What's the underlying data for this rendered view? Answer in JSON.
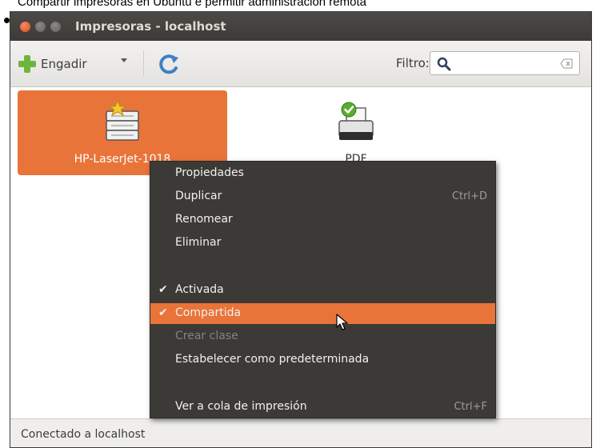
{
  "caption": "Compartir impresoras en Ubuntu e permitir administración remota",
  "window": {
    "title": "Impresoras - localhost"
  },
  "toolbar": {
    "add_label": "Engadir",
    "filter_label": "Filtro:",
    "filter_value": ""
  },
  "printers": [
    {
      "name": "HP-LaserJet-1018",
      "selected": true
    },
    {
      "name": "PDF",
      "selected": false
    }
  ],
  "context_menu": {
    "items": [
      {
        "label": "Propiedades",
        "accel": ""
      },
      {
        "label": "Duplicar",
        "accel": "Ctrl+D"
      },
      {
        "label": "Renomear",
        "accel": ""
      },
      {
        "label": "Eliminar",
        "accel": ""
      },
      {
        "label": "Activada",
        "checked": true,
        "check_mark": "✔"
      },
      {
        "label": "Compartida",
        "checked": true,
        "check_mark": "✔",
        "highlighted": true
      },
      {
        "label": "Crear clase",
        "disabled": true
      },
      {
        "label": "Estabelecer como predeterminada"
      },
      {
        "label": "Ver a cola de impresión",
        "accel": "Ctrl+F"
      }
    ]
  },
  "statusbar": {
    "text": "Conectado a localhost"
  },
  "colors": {
    "accent": "#e9743a",
    "menu_bg": "#3b3a37",
    "titlebar": "#3c3b37"
  }
}
